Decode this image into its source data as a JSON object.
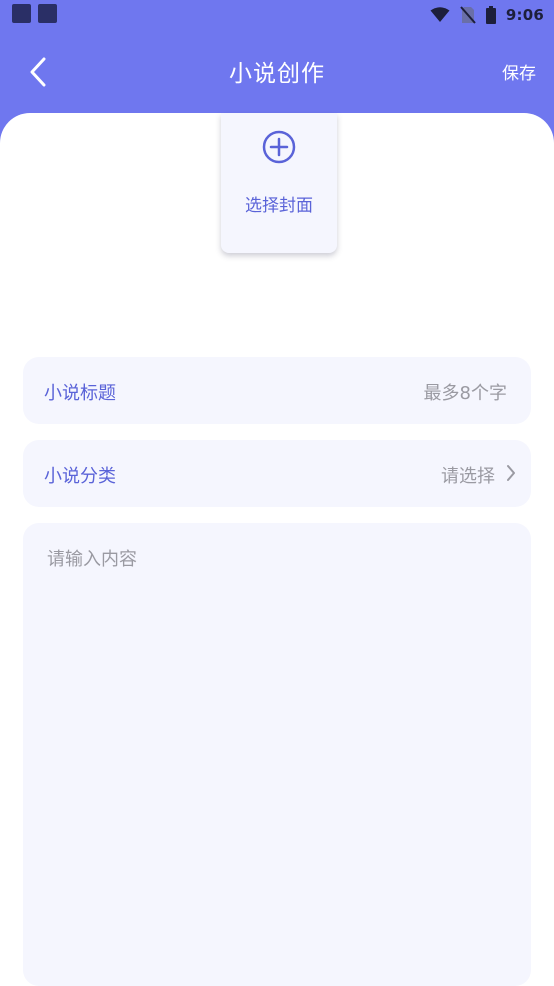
{
  "status_bar": {
    "time": "9:06",
    "icons": [
      "wifi-icon",
      "no-sim-icon",
      "battery-icon"
    ]
  },
  "header": {
    "back_icon": "chevron-left-icon",
    "title": "小说创作",
    "save_label": "保存"
  },
  "cover": {
    "icon": "plus-circle-icon",
    "label": "选择封面"
  },
  "form": {
    "title_field": {
      "label": "小说标题",
      "placeholder": "最多8个字"
    },
    "category_field": {
      "label": "小说分类",
      "value": "请选择",
      "icon": "chevron-right-icon"
    },
    "content_field": {
      "placeholder": "请输入内容"
    }
  },
  "colors": {
    "header_bg": "#6f77ef",
    "accent": "#5a63d8",
    "field_bg": "#f5f6fe",
    "hint_text": "#9a9aa2"
  }
}
